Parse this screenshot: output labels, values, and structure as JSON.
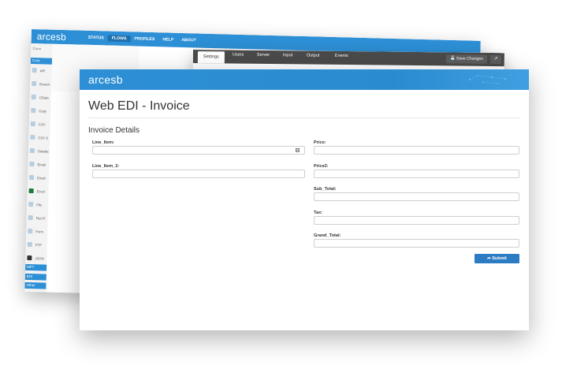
{
  "back_flows": {
    "logo": "arcesb",
    "nav": [
      "STATUS",
      "FLOWS",
      "PROFILES",
      "HELP",
      "ABOUT"
    ],
    "search_text": "Conn",
    "sidebar_head": "Core",
    "sidebar_items": [
      {
        "label": "API",
        "icon": "api-icon"
      },
      {
        "label": "Branch",
        "icon": "branch-icon"
      },
      {
        "label": "CData",
        "icon": "cdata-icon"
      },
      {
        "label": "Copy",
        "icon": "copy-icon"
      },
      {
        "label": "CSV",
        "icon": "csv-icon"
      },
      {
        "label": "CSV S",
        "icon": "csv-split-icon"
      },
      {
        "label": "Databa",
        "icon": "database-icon"
      },
      {
        "label": "Email",
        "icon": "email-icon"
      },
      {
        "label": "Email",
        "icon": "email-send-icon"
      },
      {
        "label": "Excel",
        "icon": "excel-icon"
      },
      {
        "label": "File",
        "icon": "file-icon"
      },
      {
        "label": "Flat Fi",
        "icon": "flat-file-icon"
      },
      {
        "label": "Form",
        "icon": "form-icon"
      },
      {
        "label": "FTP",
        "icon": "ftp-icon"
      },
      {
        "label": "JSON",
        "icon": "json-icon"
      }
    ],
    "sidebar_groups": [
      "MFT",
      "EDI",
      "Other"
    ]
  },
  "back_settings": {
    "tabs": [
      "Settings",
      "Users",
      "Server",
      "Input",
      "Output",
      "Events"
    ],
    "save_label": "Save Changes",
    "external_icon": "external-link-icon"
  },
  "front": {
    "logo": "arcesb",
    "title": "Web EDI - Invoice",
    "section": "Invoice Details",
    "fields_left": [
      {
        "label": "Line_Item:",
        "value": "",
        "has_calendar": true
      },
      {
        "label": "Line_Item_2:",
        "value": "",
        "has_calendar": false
      }
    ],
    "fields_right": [
      {
        "label": "Price:",
        "value": ""
      },
      {
        "label": "Price2:",
        "value": ""
      },
      {
        "label": "Sub_Total:",
        "value": ""
      },
      {
        "label": "Tax:",
        "value": ""
      },
      {
        "label": "Grand_Total:",
        "value": ""
      }
    ],
    "submit_label": "Submit"
  },
  "colors": {
    "brand_blue": "#2d8fd5",
    "submit_blue": "#2b7cc3",
    "settings_bar": "#4a4a4a"
  }
}
